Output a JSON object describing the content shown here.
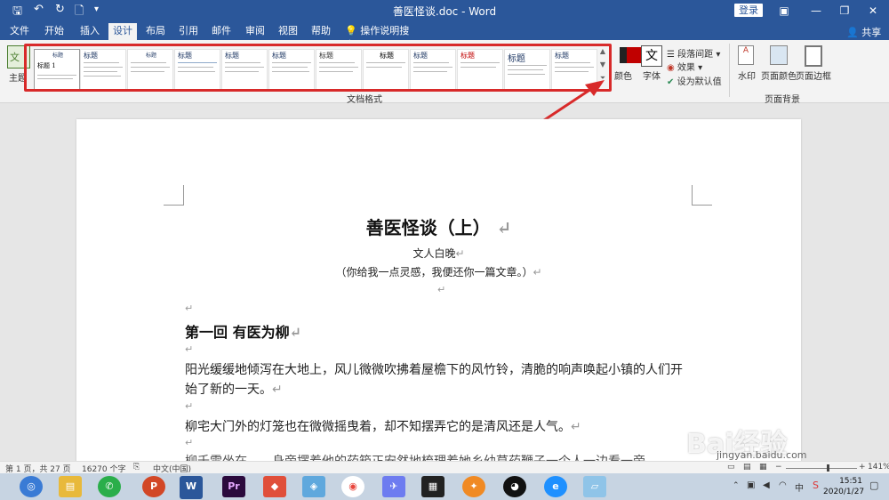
{
  "window": {
    "title": "善医怪谈.doc - Word",
    "login_label": "登录",
    "share_label": "共享"
  },
  "tabs": [
    {
      "label": "文件"
    },
    {
      "label": "开始"
    },
    {
      "label": "插入"
    },
    {
      "label": "设计"
    },
    {
      "label": "布局"
    },
    {
      "label": "引用"
    },
    {
      "label": "邮件"
    },
    {
      "label": "审阅"
    },
    {
      "label": "视图"
    },
    {
      "label": "帮助"
    }
  ],
  "tell_me": "操作说明搜索",
  "ribbon": {
    "theme_label": "主题",
    "gallery_first_title": "标题 1",
    "gallery_title": "标题",
    "group_label": "文档格式",
    "color_label": "颜色",
    "font_label": "字体",
    "paragraph_spacing": "段落间距",
    "effects": "效果",
    "set_default": "设为默认值",
    "watermark": "水印",
    "page_color": "页面颜色",
    "page_border": "页面边框",
    "background_group": "页面背景"
  },
  "document": {
    "title": "善医怪谈（上）",
    "author": "文人白晚",
    "subtitle": "（你给我一点灵感，我便还你一篇文章。）",
    "chapter": "第一回  有医为柳",
    "para1_line1": "阳光缓缓地倾泻在大地上，风儿微微吹拂着屋檐下的风竹铃，清脆的响声唤起小镇的人们开",
    "para1_line2": "始了新的一天。",
    "para2": "柳宅大门外的灯笼也在微微摇曳着，却不知摆弄它的是清风还是人气。",
    "para3_partial": "柳千雪坐在……身旁摆着他的药箱正安然地梳理着她乡幼草药鞭子一个人一边看一旁"
  },
  "statusbar": {
    "page": "第 1 页，共 27 页",
    "words": "16270 个字",
    "language": "中文(中国)",
    "zoom": "141%"
  },
  "clock": {
    "time": "15:51",
    "date": "2020/1/27"
  },
  "watermark": {
    "text": "Bai经验",
    "sub": "jingyan.baidu.com"
  }
}
